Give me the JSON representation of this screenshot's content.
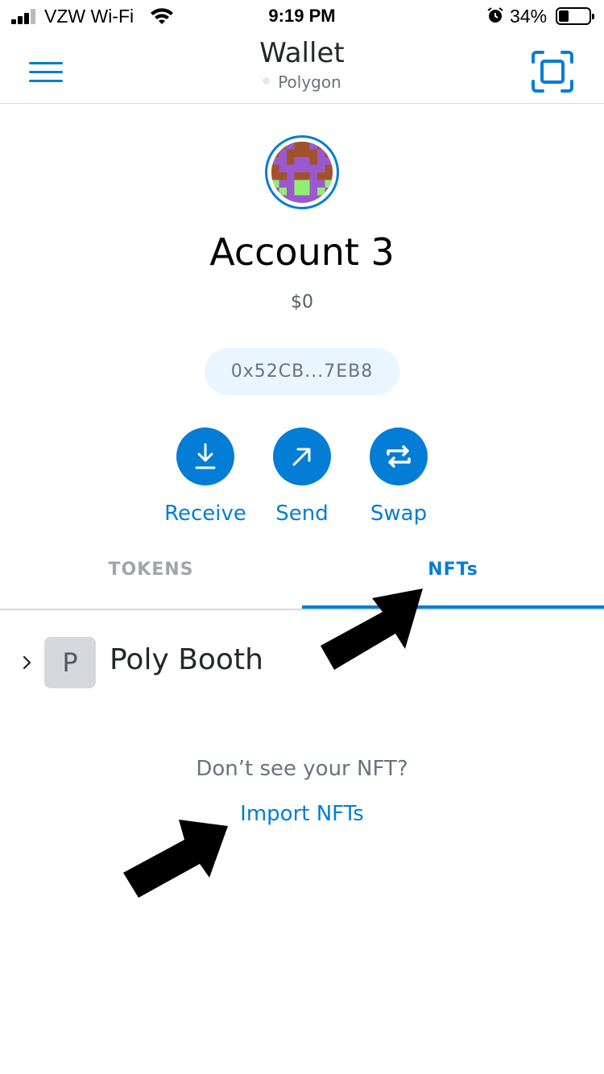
{
  "status_bar": {
    "carrier": "VZW Wi-Fi",
    "time": "9:19 PM",
    "battery": "34%",
    "battery_level": 0.34
  },
  "header": {
    "title": "Wallet",
    "network": "Polygon",
    "menu_icon": "hamburger-menu-icon",
    "scan_icon": "qr-scan-icon"
  },
  "account": {
    "name": "Account 3",
    "balance": "$0",
    "address": "0x52CB...7EB8"
  },
  "actions": [
    {
      "label": "Receive",
      "icon": "download-arrow-icon"
    },
    {
      "label": "Send",
      "icon": "diagonal-arrow-icon"
    },
    {
      "label": "Swap",
      "icon": "swap-arrows-icon"
    }
  ],
  "tabs": [
    {
      "label": "TOKENS",
      "active": false
    },
    {
      "label": "NFTs",
      "active": true
    }
  ],
  "collection": {
    "initial": "P",
    "name": "Poly Booth"
  },
  "empty_prompt": {
    "question": "Don’t see your NFT?",
    "link": "Import NFTs"
  },
  "colors": {
    "accent": "#037dd6",
    "tab_inactive": "#9fa6ae",
    "address_pill_bg": "#eaf6ff"
  }
}
